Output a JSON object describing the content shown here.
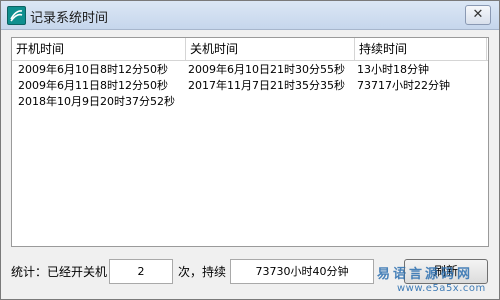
{
  "window": {
    "title": "记录系统时间",
    "close_glyph": "✕"
  },
  "listview": {
    "columns": [
      "开机时间",
      "关机时间",
      "持续时间"
    ],
    "rows": [
      [
        "2009年6月10日8时12分50秒",
        "2009年6月10日21时30分55秒",
        "13小时18分钟"
      ],
      [
        "2009年6月11日8时12分50秒",
        "2017年11月7日21时35分35秒",
        "73717小时22分钟"
      ],
      [
        "2018年10月9日20时37分52秒",
        "",
        ""
      ]
    ]
  },
  "status": {
    "label_prefix": "统计：已经开关机",
    "count_value": "2",
    "label_middle": "次，持续",
    "duration_value": "73730小时40分钟",
    "refresh_label": "刷新"
  },
  "watermark": {
    "site_name": "易语言源码网",
    "site_url": "www.e5a5x.com"
  },
  "icons": {
    "app_icon": "app-logo-icon",
    "close_icon": "close-icon"
  },
  "colors": {
    "titlebar": "#c6d6ec",
    "window_bg": "#f0f0f0",
    "watermark": "#2c6fb0",
    "app_icon": "#0f8f8f"
  }
}
